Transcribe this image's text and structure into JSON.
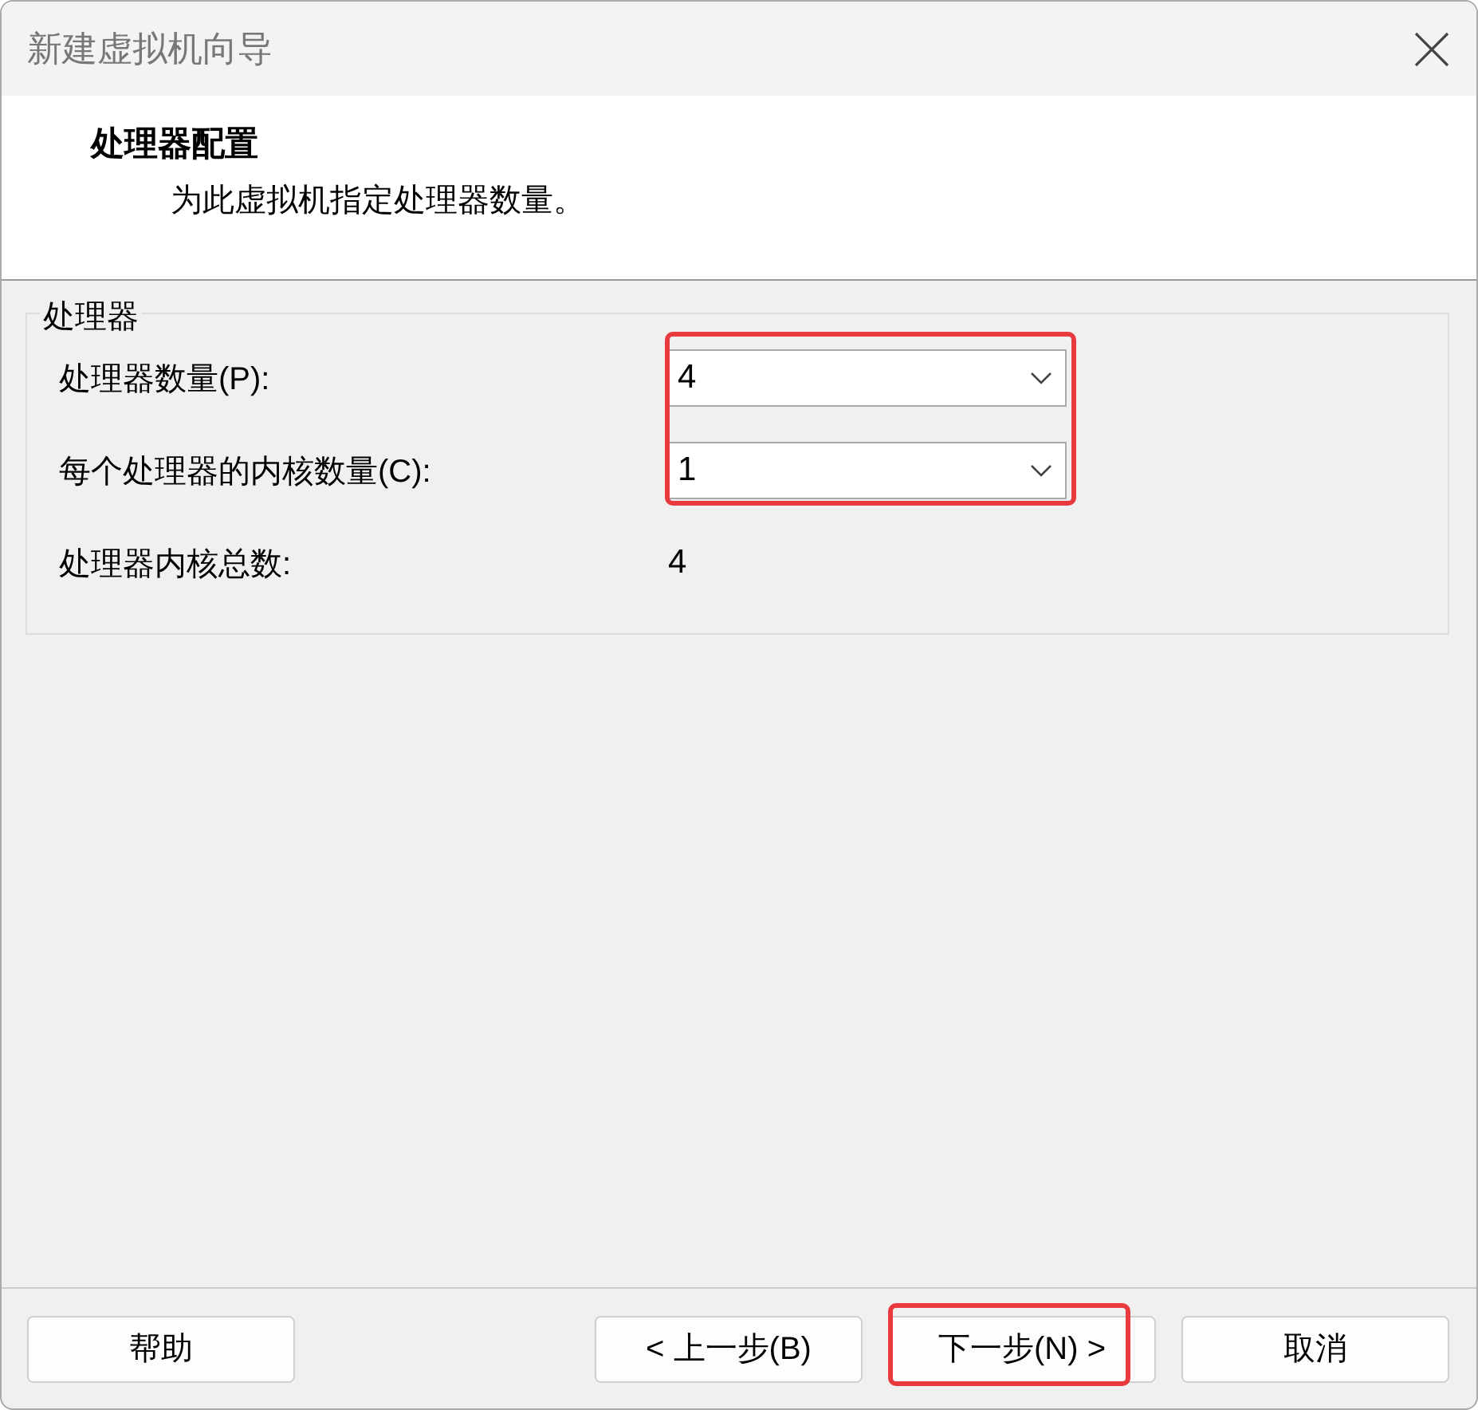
{
  "window": {
    "title": "新建虚拟机向导"
  },
  "header": {
    "title": "处理器配置",
    "subtitle": "为此虚拟机指定处理器数量。"
  },
  "group": {
    "title": "处理器",
    "highlighted": true,
    "rows": [
      {
        "kind": "dropdown",
        "label": "处理器数量(P):",
        "value": "4"
      },
      {
        "kind": "dropdown",
        "label": "每个处理器的内核数量(C):",
        "value": "1"
      },
      {
        "kind": "text",
        "label": "处理器内核总数:",
        "value": "4"
      }
    ]
  },
  "buttons": [
    {
      "label": "帮助",
      "highlighted": false
    },
    {
      "label": "< 上一步(B)",
      "highlighted": false
    },
    {
      "label": "下一步(N) >",
      "highlighted": true
    },
    {
      "label": "取消",
      "highlighted": false
    }
  ]
}
